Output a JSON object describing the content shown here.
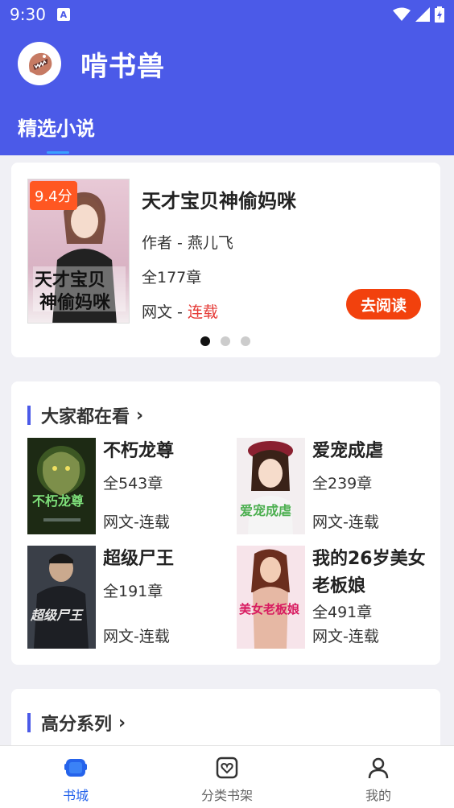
{
  "status": {
    "time": "9:30"
  },
  "app": {
    "title": "啃书兽"
  },
  "tabs": [
    {
      "label": "精选小说"
    }
  ],
  "featured": {
    "rating": "9.4分",
    "title": "天才宝贝神偷妈咪",
    "author": "作者 - 燕儿飞",
    "chapters": "全177章",
    "source": "网文 - ",
    "status": "连载",
    "read_button": "去阅读",
    "cover_text": "天才宝贝神偷妈咪"
  },
  "popular": {
    "heading": "大家都在看",
    "books": [
      {
        "title": "不朽龙尊",
        "chapters": "全543章",
        "status": "网文-连载",
        "cover_text": "不朽龙尊"
      },
      {
        "title": "爱宠成虐",
        "chapters": "全239章",
        "status": "网文-连载",
        "cover_text": "爱宠成虐"
      },
      {
        "title": "超级尸王",
        "chapters": "全191章",
        "status": "网文-连载",
        "cover_text": "超级尸王"
      },
      {
        "title": "我的26岁美女老板娘",
        "chapters": "全491章",
        "status": "网文-连载",
        "cover_text": "美女老板娘"
      }
    ]
  },
  "highscore": {
    "heading": "高分系列"
  },
  "nav": [
    {
      "label": "书城",
      "icon": "bookstore-icon",
      "active": true
    },
    {
      "label": "分类书架",
      "icon": "bookshelf-icon",
      "active": false
    },
    {
      "label": "我的",
      "icon": "user-icon",
      "active": false
    }
  ],
  "colors": {
    "primary": "#4b5ae8",
    "accent": "#f2410d",
    "status_red": "#e53935",
    "nav_active": "#2563eb"
  }
}
